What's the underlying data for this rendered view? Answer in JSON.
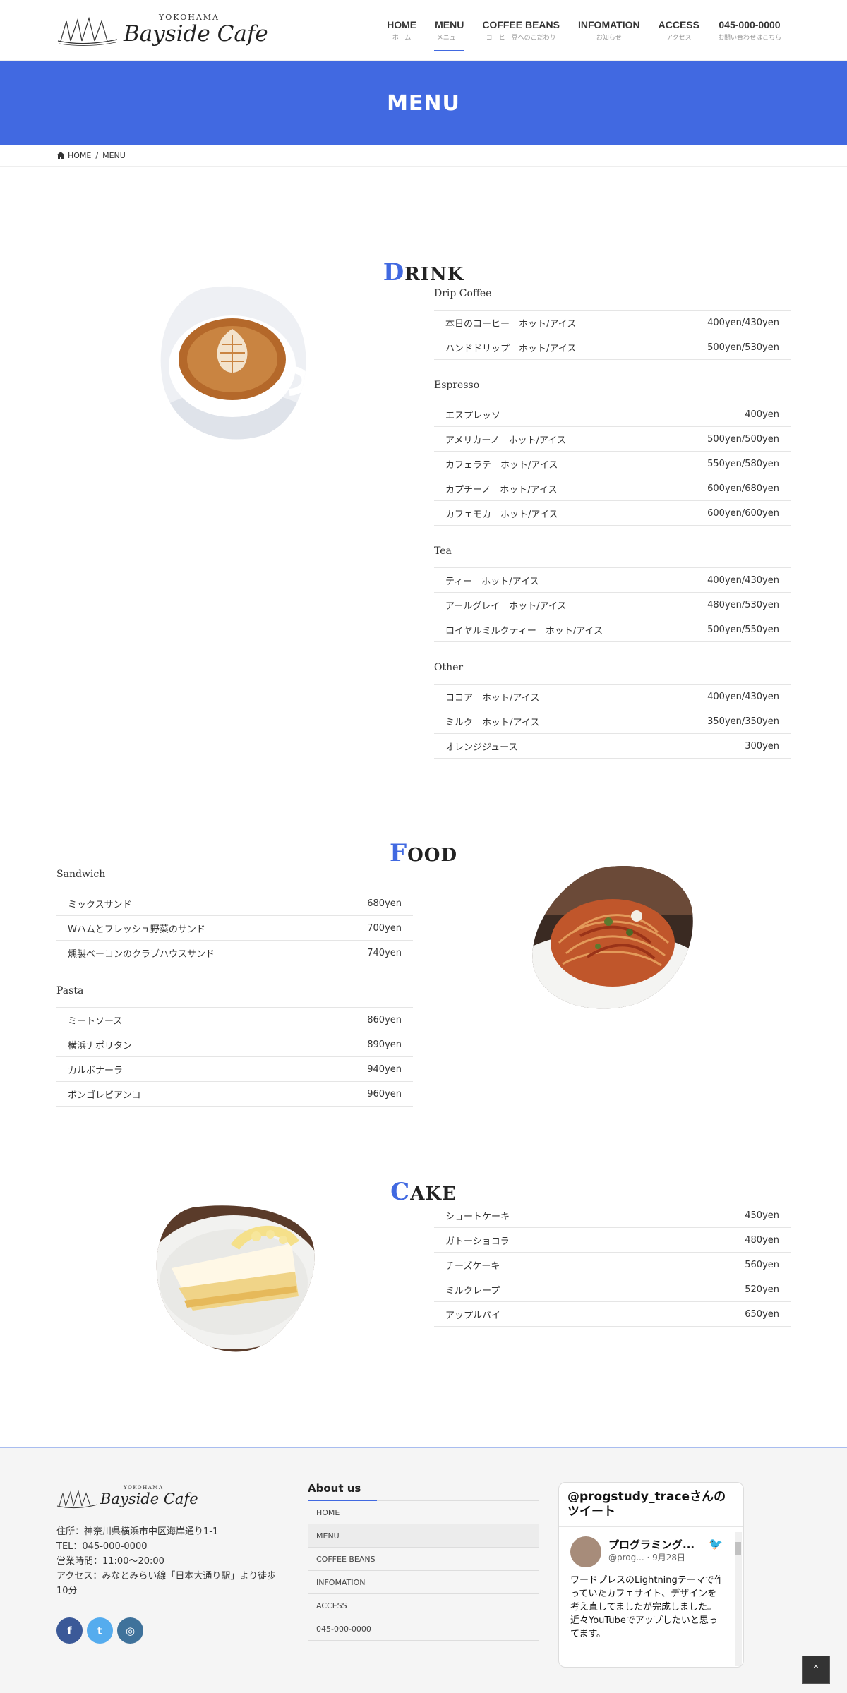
{
  "header": {
    "logo_small": "YOKOHAMA",
    "logo_text": "Bayside Cafe",
    "nav": [
      {
        "label": "HOME",
        "sub": "ホーム"
      },
      {
        "label": "MENU",
        "sub": "メニュー"
      },
      {
        "label": "COFFEE BEANS",
        "sub": "コーヒー豆へのこだわり"
      },
      {
        "label": "INFOMATION",
        "sub": "お知らせ"
      },
      {
        "label": "ACCESS",
        "sub": "アクセス"
      },
      {
        "label": "045-000-0000",
        "sub": "お問い合わせはこちら"
      }
    ]
  },
  "page_title": "MENU",
  "breadcrumb": {
    "home": "HOME",
    "sep": "/",
    "current": "MENU"
  },
  "drink": {
    "title_cap": "D",
    "title_rest": "RINK",
    "categories": [
      {
        "name": "Drip Coffee",
        "items": [
          {
            "name": "本日のコーヒー　ホット/アイス",
            "price": "400yen/430yen"
          },
          {
            "name": "ハンドドリップ　ホット/アイス",
            "price": "500yen/530yen"
          }
        ]
      },
      {
        "name": "Espresso",
        "items": [
          {
            "name": "エスプレッソ",
            "price": "400yen"
          },
          {
            "name": "アメリカーノ　ホット/アイス",
            "price": "500yen/500yen"
          },
          {
            "name": "カフェラテ　ホット/アイス",
            "price": "550yen/580yen"
          },
          {
            "name": "カプチーノ　ホット/アイス",
            "price": "600yen/680yen"
          },
          {
            "name": "カフェモカ　ホット/アイス",
            "price": "600yen/600yen"
          }
        ]
      },
      {
        "name": "Tea",
        "items": [
          {
            "name": "ティー　ホット/アイス",
            "price": "400yen/430yen"
          },
          {
            "name": "アールグレイ　ホット/アイス",
            "price": "480yen/530yen"
          },
          {
            "name": "ロイヤルミルクティー　ホット/アイス",
            "price": "500yen/550yen"
          }
        ]
      },
      {
        "name": "Other",
        "items": [
          {
            "name": "ココア　ホット/アイス",
            "price": "400yen/430yen"
          },
          {
            "name": "ミルク　ホット/アイス",
            "price": "350yen/350yen"
          },
          {
            "name": "オレンジジュース",
            "price": "300yen"
          }
        ]
      }
    ]
  },
  "food": {
    "title_cap": "F",
    "title_rest": "OOD",
    "categories": [
      {
        "name": "Sandwich",
        "items": [
          {
            "name": "ミックスサンド",
            "price": "680yen"
          },
          {
            "name": "Wハムとフレッシュ野菜のサンド",
            "price": "700yen"
          },
          {
            "name": "燻製ベーコンのクラブハウスサンド",
            "price": "740yen"
          }
        ]
      },
      {
        "name": "Pasta",
        "items": [
          {
            "name": "ミートソース",
            "price": "860yen"
          },
          {
            "name": "横浜ナポリタン",
            "price": "890yen"
          },
          {
            "name": "カルボナーラ",
            "price": "940yen"
          },
          {
            "name": "ボンゴレビアンコ",
            "price": "960yen"
          }
        ]
      }
    ]
  },
  "cake": {
    "title_cap": "C",
    "title_rest": "AKE",
    "items": [
      {
        "name": "ショートケーキ",
        "price": "450yen"
      },
      {
        "name": "ガトーショコラ",
        "price": "480yen"
      },
      {
        "name": "チーズケーキ",
        "price": "560yen"
      },
      {
        "name": "ミルクレープ",
        "price": "520yen"
      },
      {
        "name": "アップルパイ",
        "price": "650yen"
      }
    ]
  },
  "footer": {
    "logo_small": "YOKOHAMA",
    "logo_text": "Bayside Cafe",
    "address": "住所：神奈川県横浜市中区海岸通り1-1",
    "tel": "TEL：045-000-0000",
    "hours": "営業時間：11:00〜20:00",
    "access": "アクセス：みなとみらい線「日本大通り駅」より徒歩10分",
    "about_title": "About us",
    "links": [
      "HOME",
      "MENU",
      "COFFEE BEANS",
      "INFOMATION",
      "ACCESS",
      "045-000-0000"
    ],
    "twitter": {
      "header": "@progstudy_traceさんのツイート",
      "name": "プログラミング...",
      "handle": "@prog... · 9月28日",
      "text": "ワードプレスのLightningテーマで作っていたカフェサイト、デザインを考え直してましたが完成しました。\n近々YouTubeでアップしたいと思ってます。"
    }
  },
  "colors": {
    "accent": "#4169e1",
    "facebook": "#3b5998",
    "twitter": "#55acee",
    "instagram": "#3f729b"
  }
}
